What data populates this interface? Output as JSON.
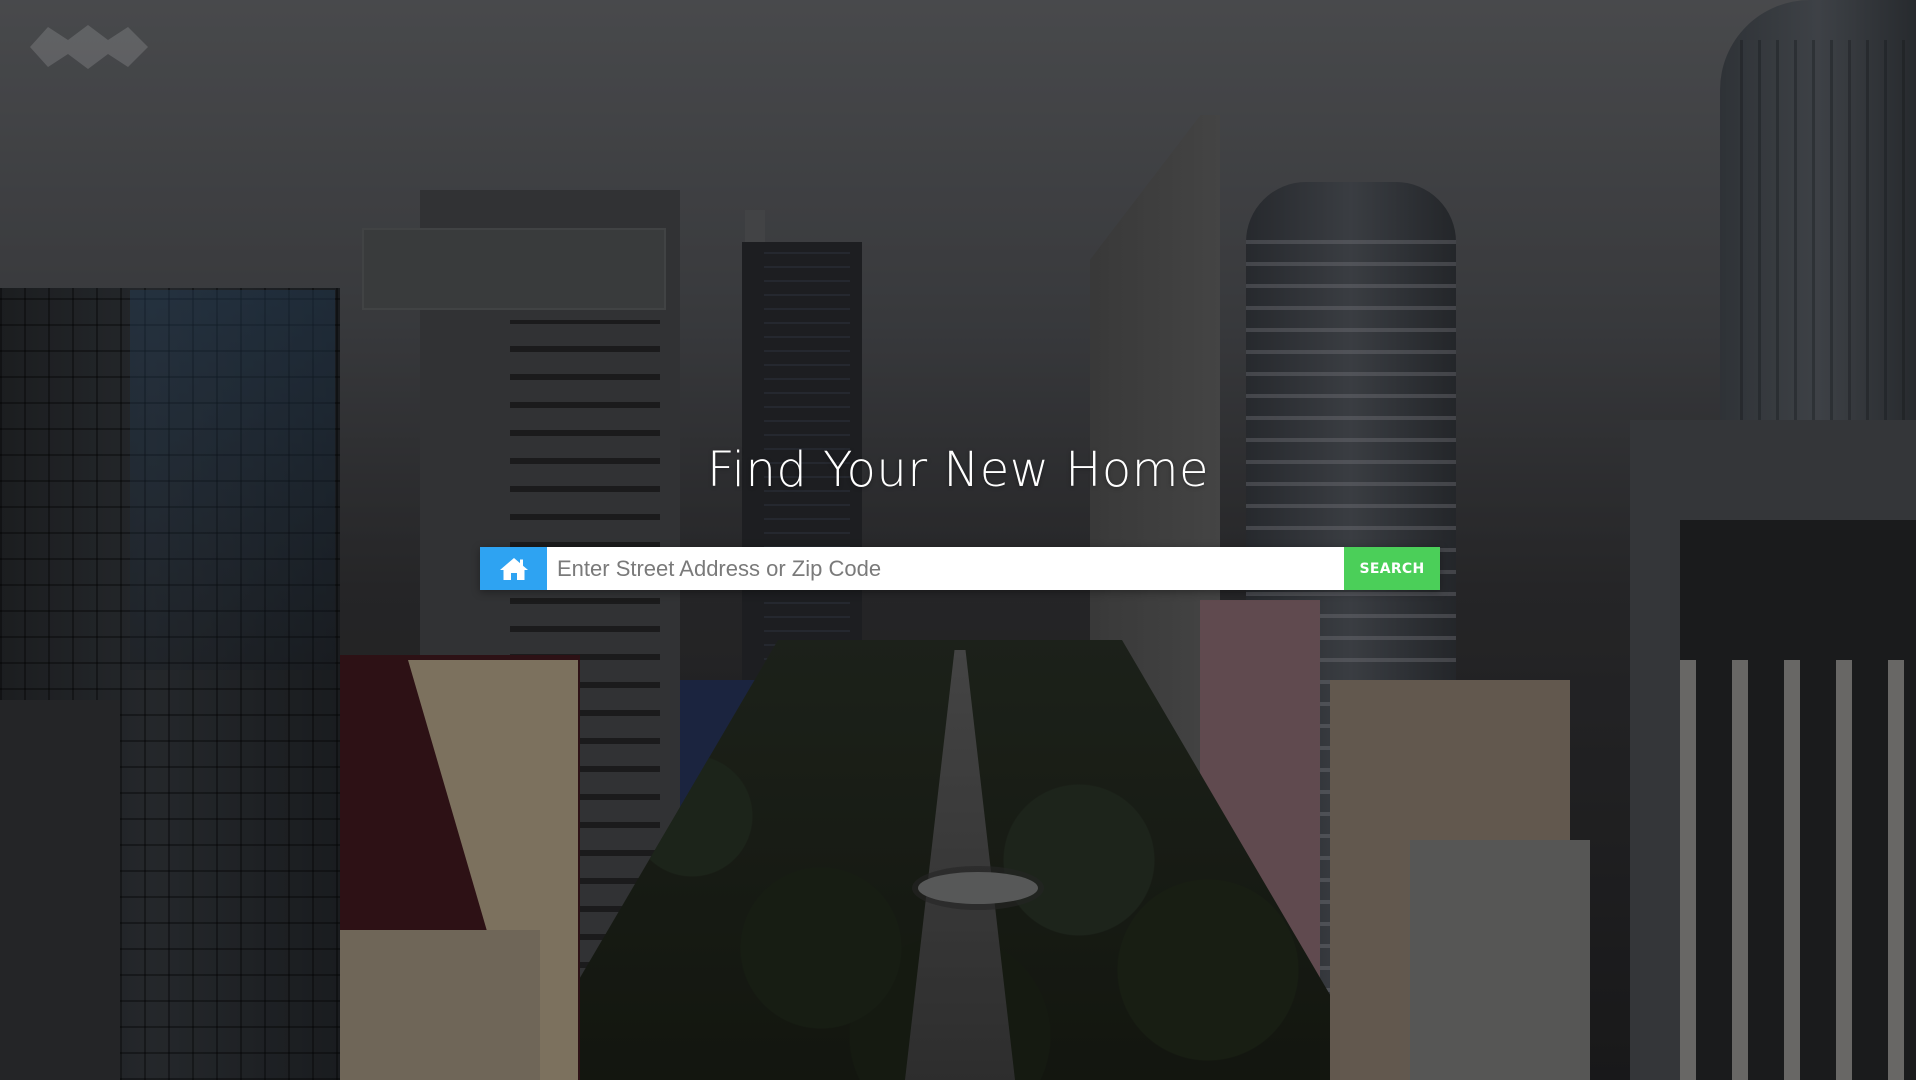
{
  "hero": {
    "headline": "Find Your New Home",
    "background": "aerial city skyline photo"
  },
  "logo": {
    "icon": "logo-icon"
  },
  "search": {
    "home_icon": "home-icon",
    "placeholder": "Enter Street Address or Zip Code",
    "value": "",
    "button_label": "SEARCH"
  },
  "colors": {
    "home_button": "#2ea3f2",
    "search_button": "#4bcf59",
    "headline_text": "#ffffff"
  }
}
